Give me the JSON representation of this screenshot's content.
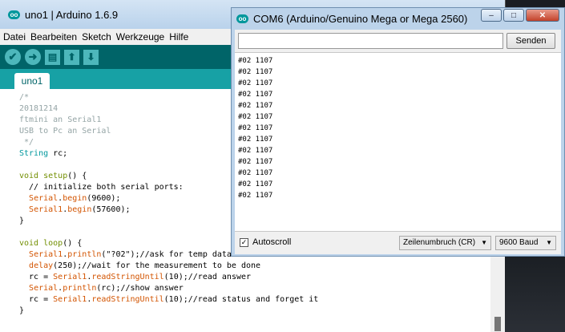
{
  "ide": {
    "logo": "oo",
    "title": "uno1 | Arduino 1.6.9",
    "menu": [
      "Datei",
      "Bearbeiten",
      "Sketch",
      "Werkzeuge",
      "Hilfe"
    ],
    "toolbar": {
      "verify_icon": "check-icon",
      "upload_icon": "right-arrow-icon",
      "new_icon": "new-file-icon",
      "open_icon": "up-arrow-icon",
      "save_icon": "down-arrow-icon"
    },
    "tab_label": "uno1",
    "code": [
      [
        {
          "t": "/*",
          "c": "comment"
        }
      ],
      [
        {
          "t": "20181214",
          "c": "comment"
        }
      ],
      [
        {
          "t": "ftmini an Serial1",
          "c": "comment"
        }
      ],
      [
        {
          "t": "USB to Pc an Serial",
          "c": "comment"
        }
      ],
      [
        {
          "t": " */",
          "c": "comment"
        }
      ],
      [
        {
          "t": "String",
          "c": "type"
        },
        {
          "t": " rc;",
          "c": ""
        }
      ],
      [],
      [
        {
          "t": "void",
          "c": "kw"
        },
        {
          "t": " ",
          "c": ""
        },
        {
          "t": "setup",
          "c": "kw"
        },
        {
          "t": "() {",
          "c": ""
        }
      ],
      [
        {
          "t": "  // initialize both serial ports:",
          "c": ""
        }
      ],
      [
        {
          "t": "  ",
          "c": ""
        },
        {
          "t": "Serial",
          "c": "fn"
        },
        {
          "t": ".",
          "c": ""
        },
        {
          "t": "begin",
          "c": "fn"
        },
        {
          "t": "(9600);",
          "c": ""
        }
      ],
      [
        {
          "t": "  ",
          "c": ""
        },
        {
          "t": "Serial1",
          "c": "fn"
        },
        {
          "t": ".",
          "c": ""
        },
        {
          "t": "begin",
          "c": "fn"
        },
        {
          "t": "(57600);",
          "c": ""
        }
      ],
      [
        {
          "t": "}",
          "c": ""
        }
      ],
      [],
      [
        {
          "t": "void",
          "c": "kw"
        },
        {
          "t": " ",
          "c": ""
        },
        {
          "t": "loop",
          "c": "kw"
        },
        {
          "t": "() {",
          "c": ""
        }
      ],
      [
        {
          "t": "  ",
          "c": ""
        },
        {
          "t": "Serial1",
          "c": "fn"
        },
        {
          "t": ".",
          "c": ""
        },
        {
          "t": "println",
          "c": "fn"
        },
        {
          "t": "(\"?02\");//ask for temp data",
          "c": ""
        }
      ],
      [
        {
          "t": "  ",
          "c": ""
        },
        {
          "t": "delay",
          "c": "fn"
        },
        {
          "t": "(250);//wait for the measurement to be done",
          "c": ""
        }
      ],
      [
        {
          "t": "  rc = ",
          "c": ""
        },
        {
          "t": "Serial1",
          "c": "fn"
        },
        {
          "t": ".",
          "c": ""
        },
        {
          "t": "readStringUntil",
          "c": "fn"
        },
        {
          "t": "(10);//read answer",
          "c": ""
        }
      ],
      [
        {
          "t": "  ",
          "c": ""
        },
        {
          "t": "Serial",
          "c": "fn"
        },
        {
          "t": ".",
          "c": ""
        },
        {
          "t": "println",
          "c": "fn"
        },
        {
          "t": "(rc);//show answer",
          "c": ""
        }
      ],
      [
        {
          "t": "  rc = ",
          "c": ""
        },
        {
          "t": "Serial1",
          "c": "fn"
        },
        {
          "t": ".",
          "c": ""
        },
        {
          "t": "readStringUntil",
          "c": "fn"
        },
        {
          "t": "(10);//read status and forget it",
          "c": ""
        }
      ],
      [
        {
          "t": "}",
          "c": ""
        }
      ]
    ]
  },
  "serial_monitor": {
    "logo": "oo",
    "title": "COM6 (Arduino/Genuino Mega or Mega 2560)",
    "window_buttons": {
      "minimize": "–",
      "maximize": "□",
      "close": "✕"
    },
    "send_input": {
      "value": "",
      "placeholder": ""
    },
    "send_label": "Senden",
    "output": [
      "#02 1107",
      "#02 1107",
      "#02 1107",
      "#02 1107",
      "#02 1107",
      "#02 1107",
      "#02 1107",
      "#02 1107",
      "#02 1107",
      "#02 1107",
      "#02 1107",
      "#02 1107",
      "#02 1107"
    ],
    "autoscroll": {
      "label": "Autoscroll",
      "checked": true,
      "mark": "✓"
    },
    "line_ending": "Zeilenumbruch (CR)",
    "baud": "9600 Baud",
    "dropdown_arrow": "▼"
  },
  "colors": {
    "teal_dark": "#006468",
    "teal_mid": "#17a1a5",
    "comment": "#95a5a6",
    "type": "#00979d",
    "keyword": "#728e00",
    "function": "#d35400"
  }
}
